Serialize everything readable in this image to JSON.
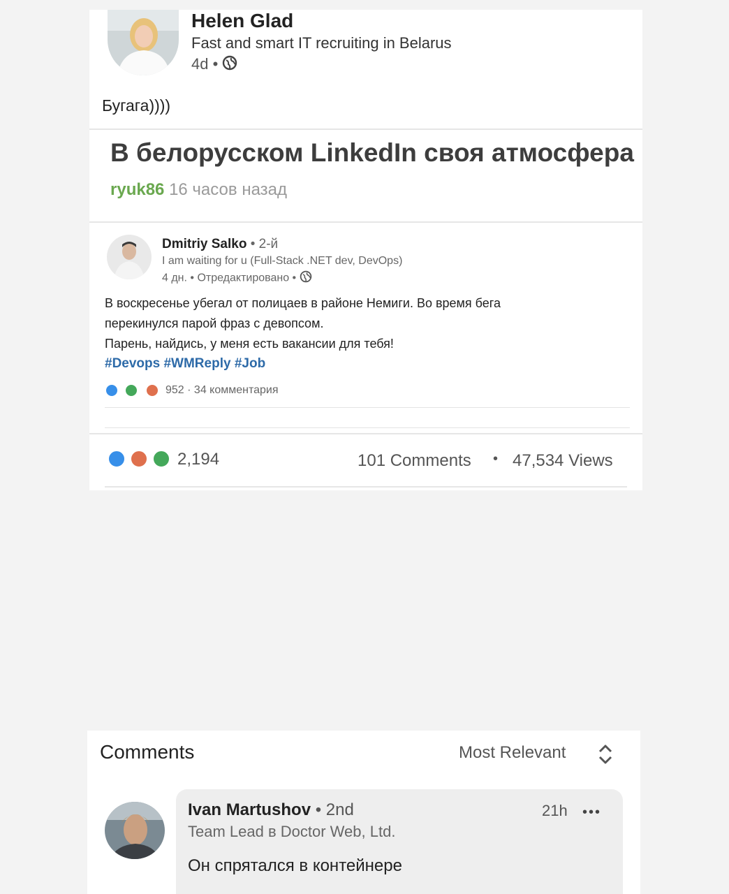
{
  "post": {
    "author_name": "Helen Glad",
    "author_headline": "Fast and smart IT recruiting in Belarus",
    "age": "4d",
    "visibility_icon": "globe-icon",
    "text": "Бугага))))"
  },
  "article": {
    "title": "В белорусском LinkedIn своя атмосфера",
    "author": "ryuk86",
    "time": "16 часов назад",
    "author_color": "#6aa84f"
  },
  "embedded_post": {
    "author_name": "Dmitriy Salko",
    "degree": "• 2-й",
    "headline": "I am waiting for u (Full-Stack .NET dev, DevOps)",
    "meta": "4 дн. • Отредактировано •",
    "body_lines": [
      "В воскресенье убегал от полицаев в районе Немиги. Во время бега",
      "перекинулся парой фраз с девопсом.",
      "Парень, найдись, у меня есть вакансии для тебя!"
    ],
    "hashtags": "#Devops #WMReply #Job",
    "reactions_summary": "952 · 34 комментария"
  },
  "stats": {
    "reactions_count": "2,194",
    "comments": "101 Comments",
    "separator": "•",
    "views": "47,534 Views"
  },
  "comments": {
    "header": "Comments",
    "sort_label": "Most Relevant",
    "items": [
      {
        "author_name": "Ivan Martushov",
        "degree": "• 2nd",
        "headline": "Team Lead в Doctor Web, Ltd.",
        "time": "21h",
        "more": "•••",
        "text": "Он спрятался в контейнере"
      }
    ]
  },
  "colors": {
    "like": "#378fe9",
    "love": "#df704d",
    "support": "#44a85a",
    "hashtag": "#2d6aa8"
  }
}
